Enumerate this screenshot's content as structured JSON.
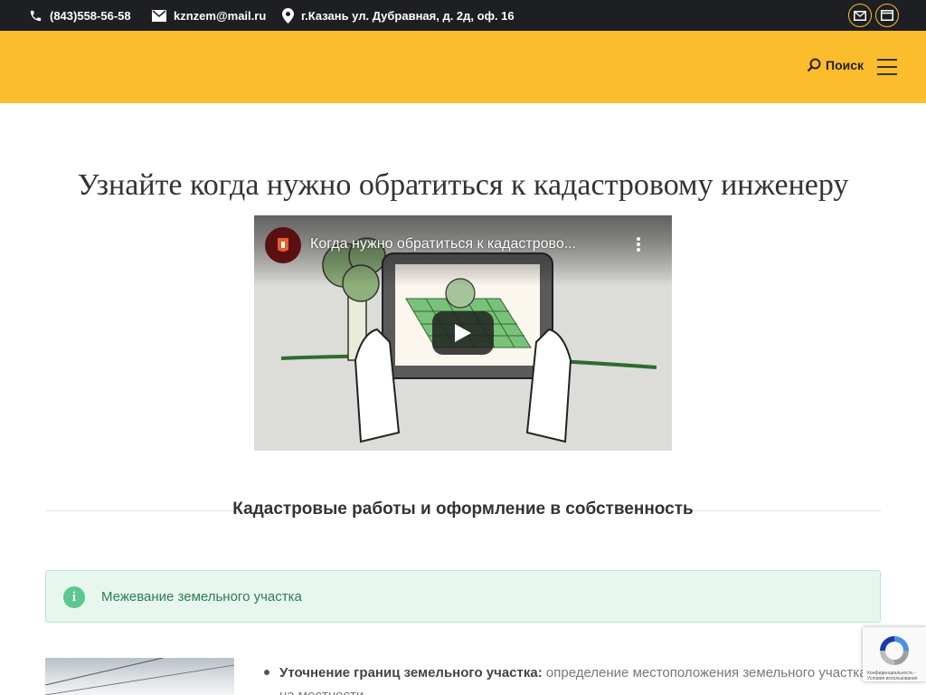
{
  "topbar": {
    "phone": "(843)558-56-58",
    "email": "kznzem@mail.ru",
    "address": "г.Казань ул. Дубравная, д. 2д, оф. 16"
  },
  "header": {
    "search_label": "Поиск"
  },
  "page_title": "Узнайте когда нужно обратиться к кадастровому инженеру",
  "video": {
    "title": "Когда нужно обратиться к кадастрово..."
  },
  "section_heading": "Кадастровые работы и оформление в собственность",
  "info_box": {
    "text": "Межевание земельного участка"
  },
  "list": {
    "item1_bold": "Уточнение границ земельного участка:",
    "item1_text": " определение местоположения земельного участка на местности"
  },
  "recaptcha": {
    "text": "Конфиденциальность - Условия использования"
  },
  "colors": {
    "accent": "#fcbd2c",
    "topbar": "#1d1f22",
    "info_bg": "#e7f7ef"
  }
}
